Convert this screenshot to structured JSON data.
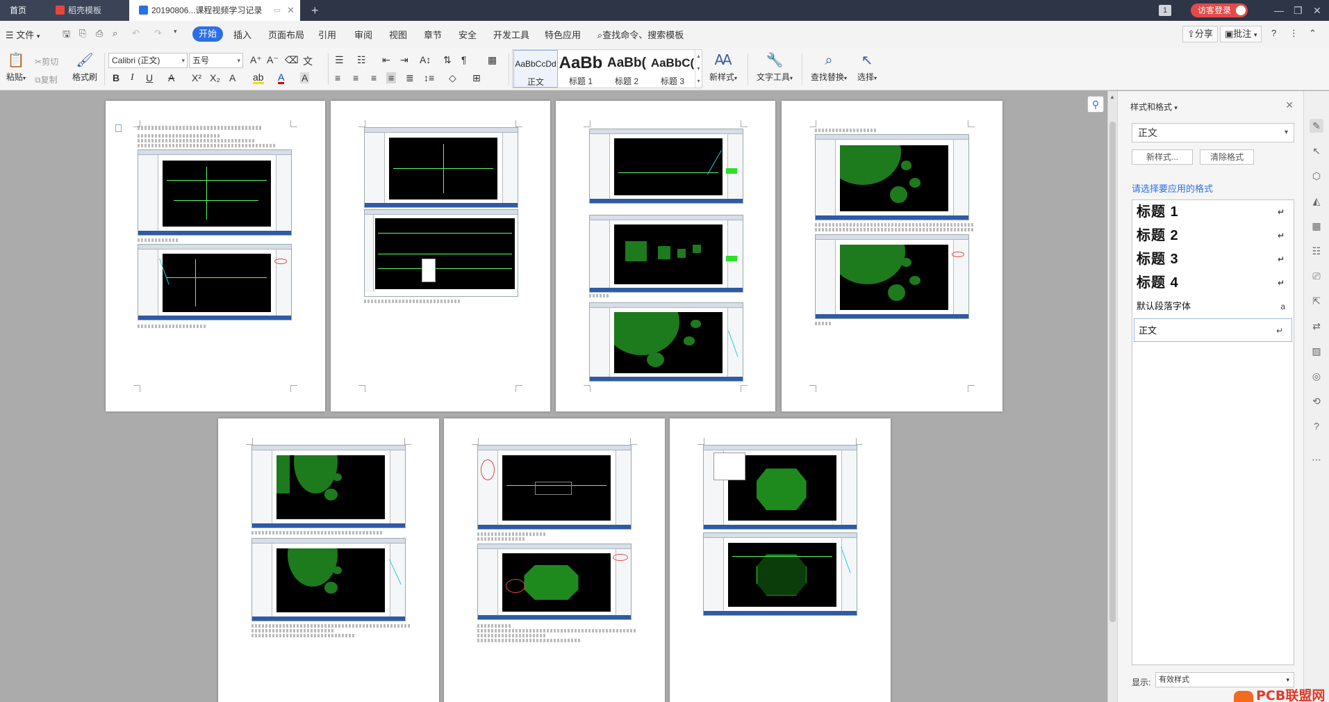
{
  "tabs": [
    {
      "label": "首页"
    },
    {
      "label": "稻壳模板"
    },
    {
      "label": "20190806...课程视频学习记录"
    }
  ],
  "titlebar": {
    "badge": "1",
    "login": "访客登录"
  },
  "menu": {
    "file": "文件",
    "items": [
      "开始",
      "插入",
      "页面布局",
      "引用",
      "审阅",
      "视图",
      "章节",
      "安全",
      "开发工具",
      "特色应用"
    ],
    "search": "查找命令、搜索模板",
    "share": "分享",
    "comment": "批注",
    "help": "?"
  },
  "ribbon": {
    "paste": "粘贴",
    "cut": "剪切",
    "copy": "复制",
    "format_painter": "格式刷",
    "font_name": "Calibri (正文)",
    "font_size": "五号",
    "styles": [
      {
        "preview": "AaBbCcDd",
        "name": "正文"
      },
      {
        "preview": "AaBb",
        "name": "标题 1"
      },
      {
        "preview": "AaBb(",
        "name": "标题 2"
      },
      {
        "preview": "AaBbC(",
        "name": "标题 3"
      }
    ],
    "new_style": "新样式",
    "text_tools": "文字工具",
    "find_replace": "查找替换",
    "select": "选择"
  },
  "style_pane": {
    "title": "样式和格式",
    "current": "正文",
    "new_style_btn": "新样式...",
    "clear_btn": "清除格式",
    "hint": "请选择要应用的格式",
    "items": [
      {
        "label": "标题 1",
        "mark": "↵"
      },
      {
        "label": "标题 2",
        "mark": "↵"
      },
      {
        "label": "标题 3",
        "mark": "↵"
      },
      {
        "label": "标题 4",
        "mark": "↵"
      },
      {
        "label": "默认段落字体",
        "mark": "a"
      },
      {
        "label": "正文",
        "mark": "↵"
      }
    ],
    "show_label": "显示:",
    "show_value": "有效样式"
  },
  "watermark": "PCB联盟网"
}
